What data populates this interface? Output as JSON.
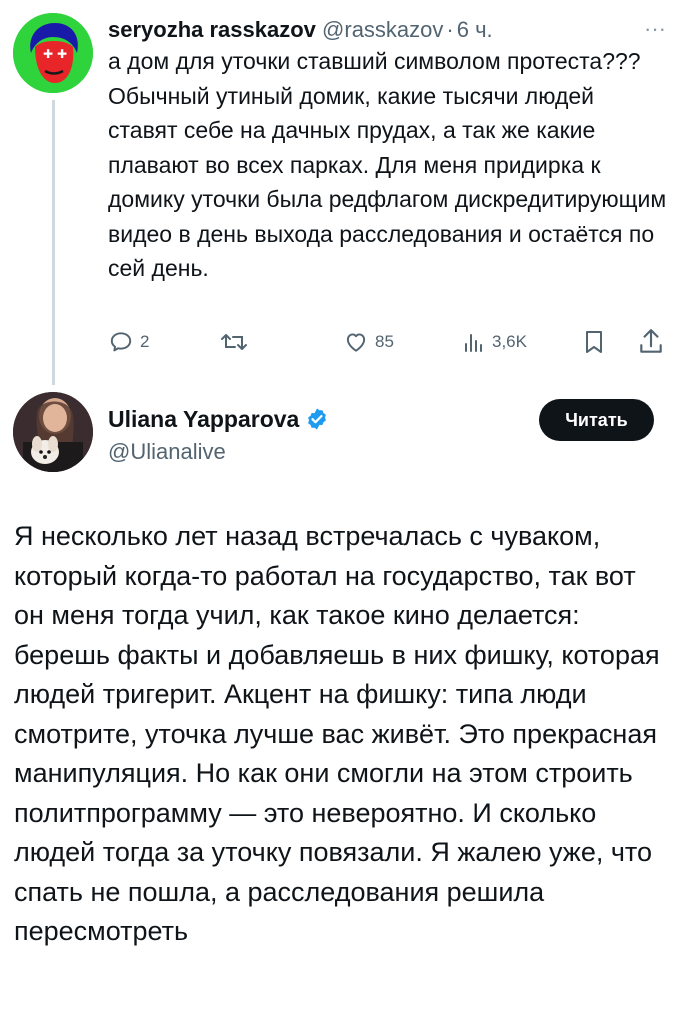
{
  "reply": {
    "author_name": "seryozha rasskazov",
    "author_handle": "@rasskazov",
    "separator": "·",
    "time": "6 ч.",
    "text": "а дом для уточки ставший символом протеста??? Обычный утиный домик, какие тысячи людей ставят себе на дачных прудах, а так же какие плавают во всех парках. Для меня придирка к домику уточки была редфлагом дискредитирующим видео в день выхода расследования и остаётся по сей день.",
    "more_icon": "more-icon",
    "actions": {
      "reply_count": "2",
      "retweet_count": "",
      "like_count": "85",
      "views_count": "3,6K"
    }
  },
  "tweet": {
    "author_name": "Uliana Yapparova",
    "author_handle": "@Ulianalive",
    "verified": true,
    "verified_color": "#1d9bf0",
    "follow_label": "Читать",
    "text": "Я несколько лет назад встречалась с чуваком, который когда-то работал на государство, так вот он меня тогда учил, как такое кино делается: берешь факты и добавляешь в них фишку, которая людей тригерит. Акцент на фишку: типа люди смотрите, уточка лучше вас живёт. Это прекрасная манипуляция. Но как они смогли на этом строить политпрограмму — это невероятно. И сколько людей тогда за уточку повязали. Я жалею уже, что спать не пошла, а расследования решила пересмотреть"
  }
}
